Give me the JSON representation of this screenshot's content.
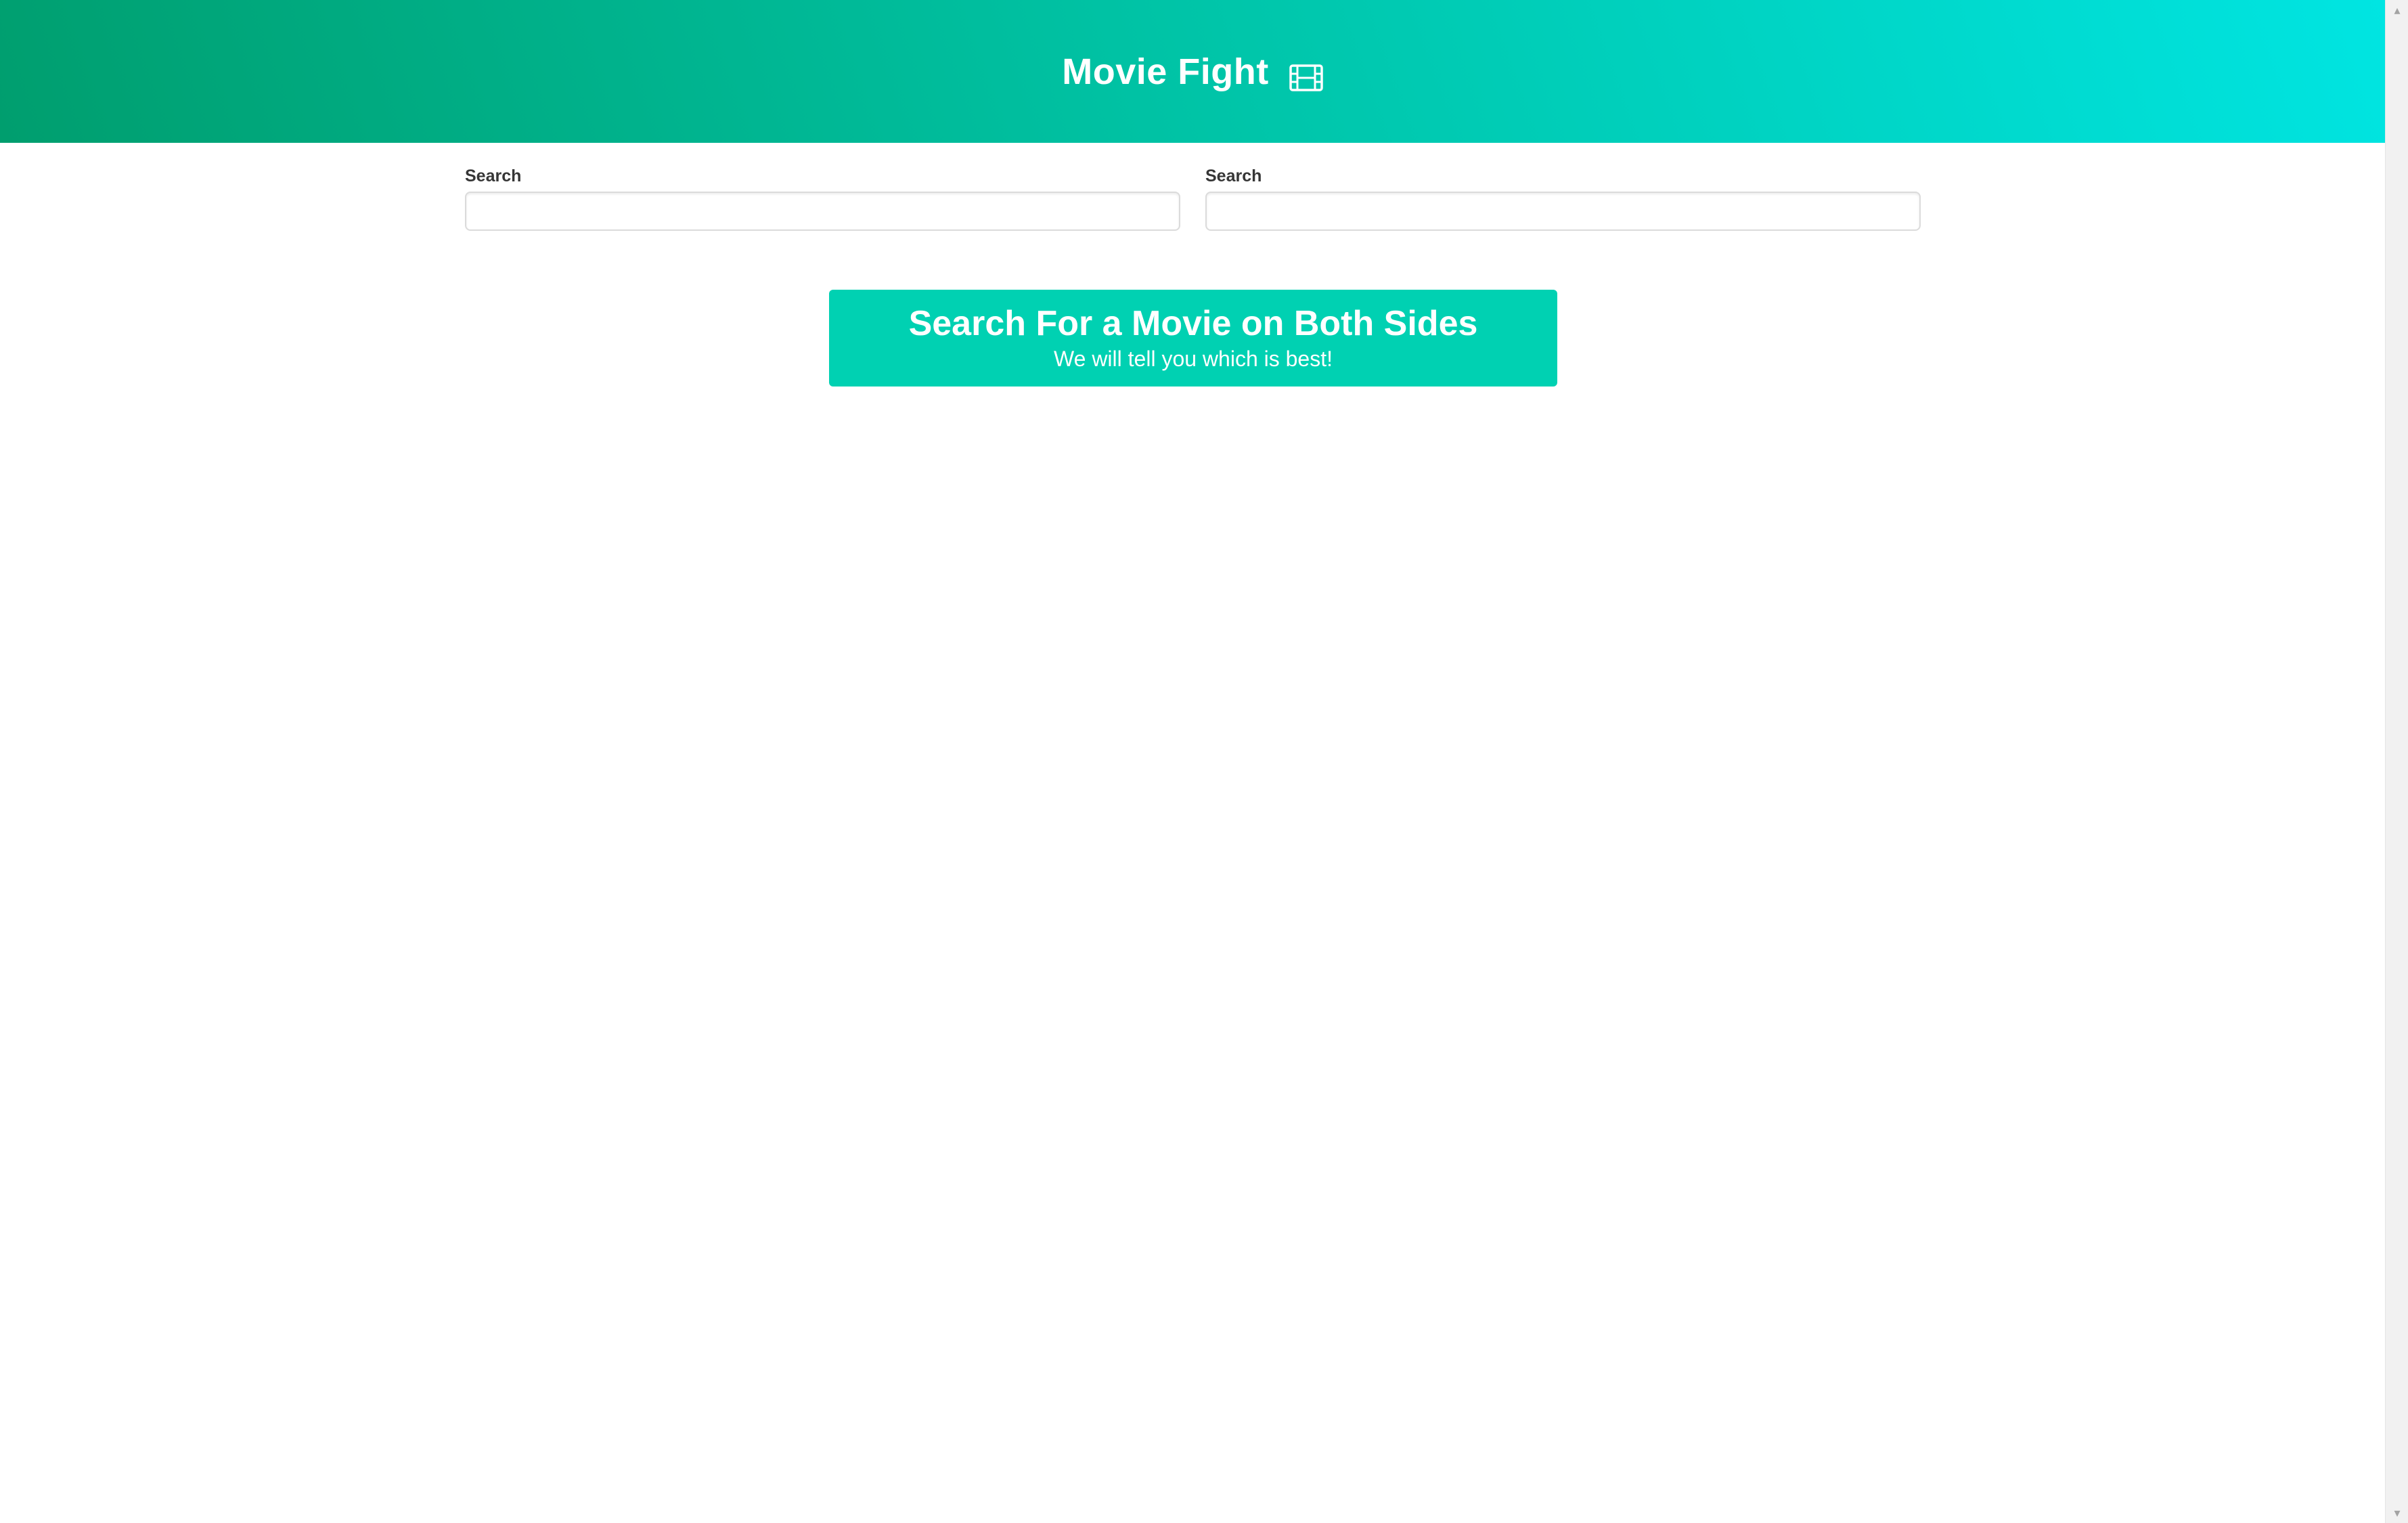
{
  "app": {
    "title": "Movie Fight",
    "icon": "film-icon",
    "hero_gradient": [
      "#009e6e",
      "#00c4a7",
      "#00e5e2"
    ]
  },
  "search_left": {
    "label": "Search",
    "value": "",
    "placeholder": ""
  },
  "search_right": {
    "label": "Search",
    "value": "",
    "placeholder": ""
  },
  "tutorial": {
    "title": "Search For a Movie on Both Sides",
    "subtitle": "We will tell you which is best!",
    "color": "#00d1b2"
  },
  "scrollbar": {
    "up_icon": "scroll-up-arrow-icon",
    "down_icon": "scroll-down-arrow-icon"
  }
}
